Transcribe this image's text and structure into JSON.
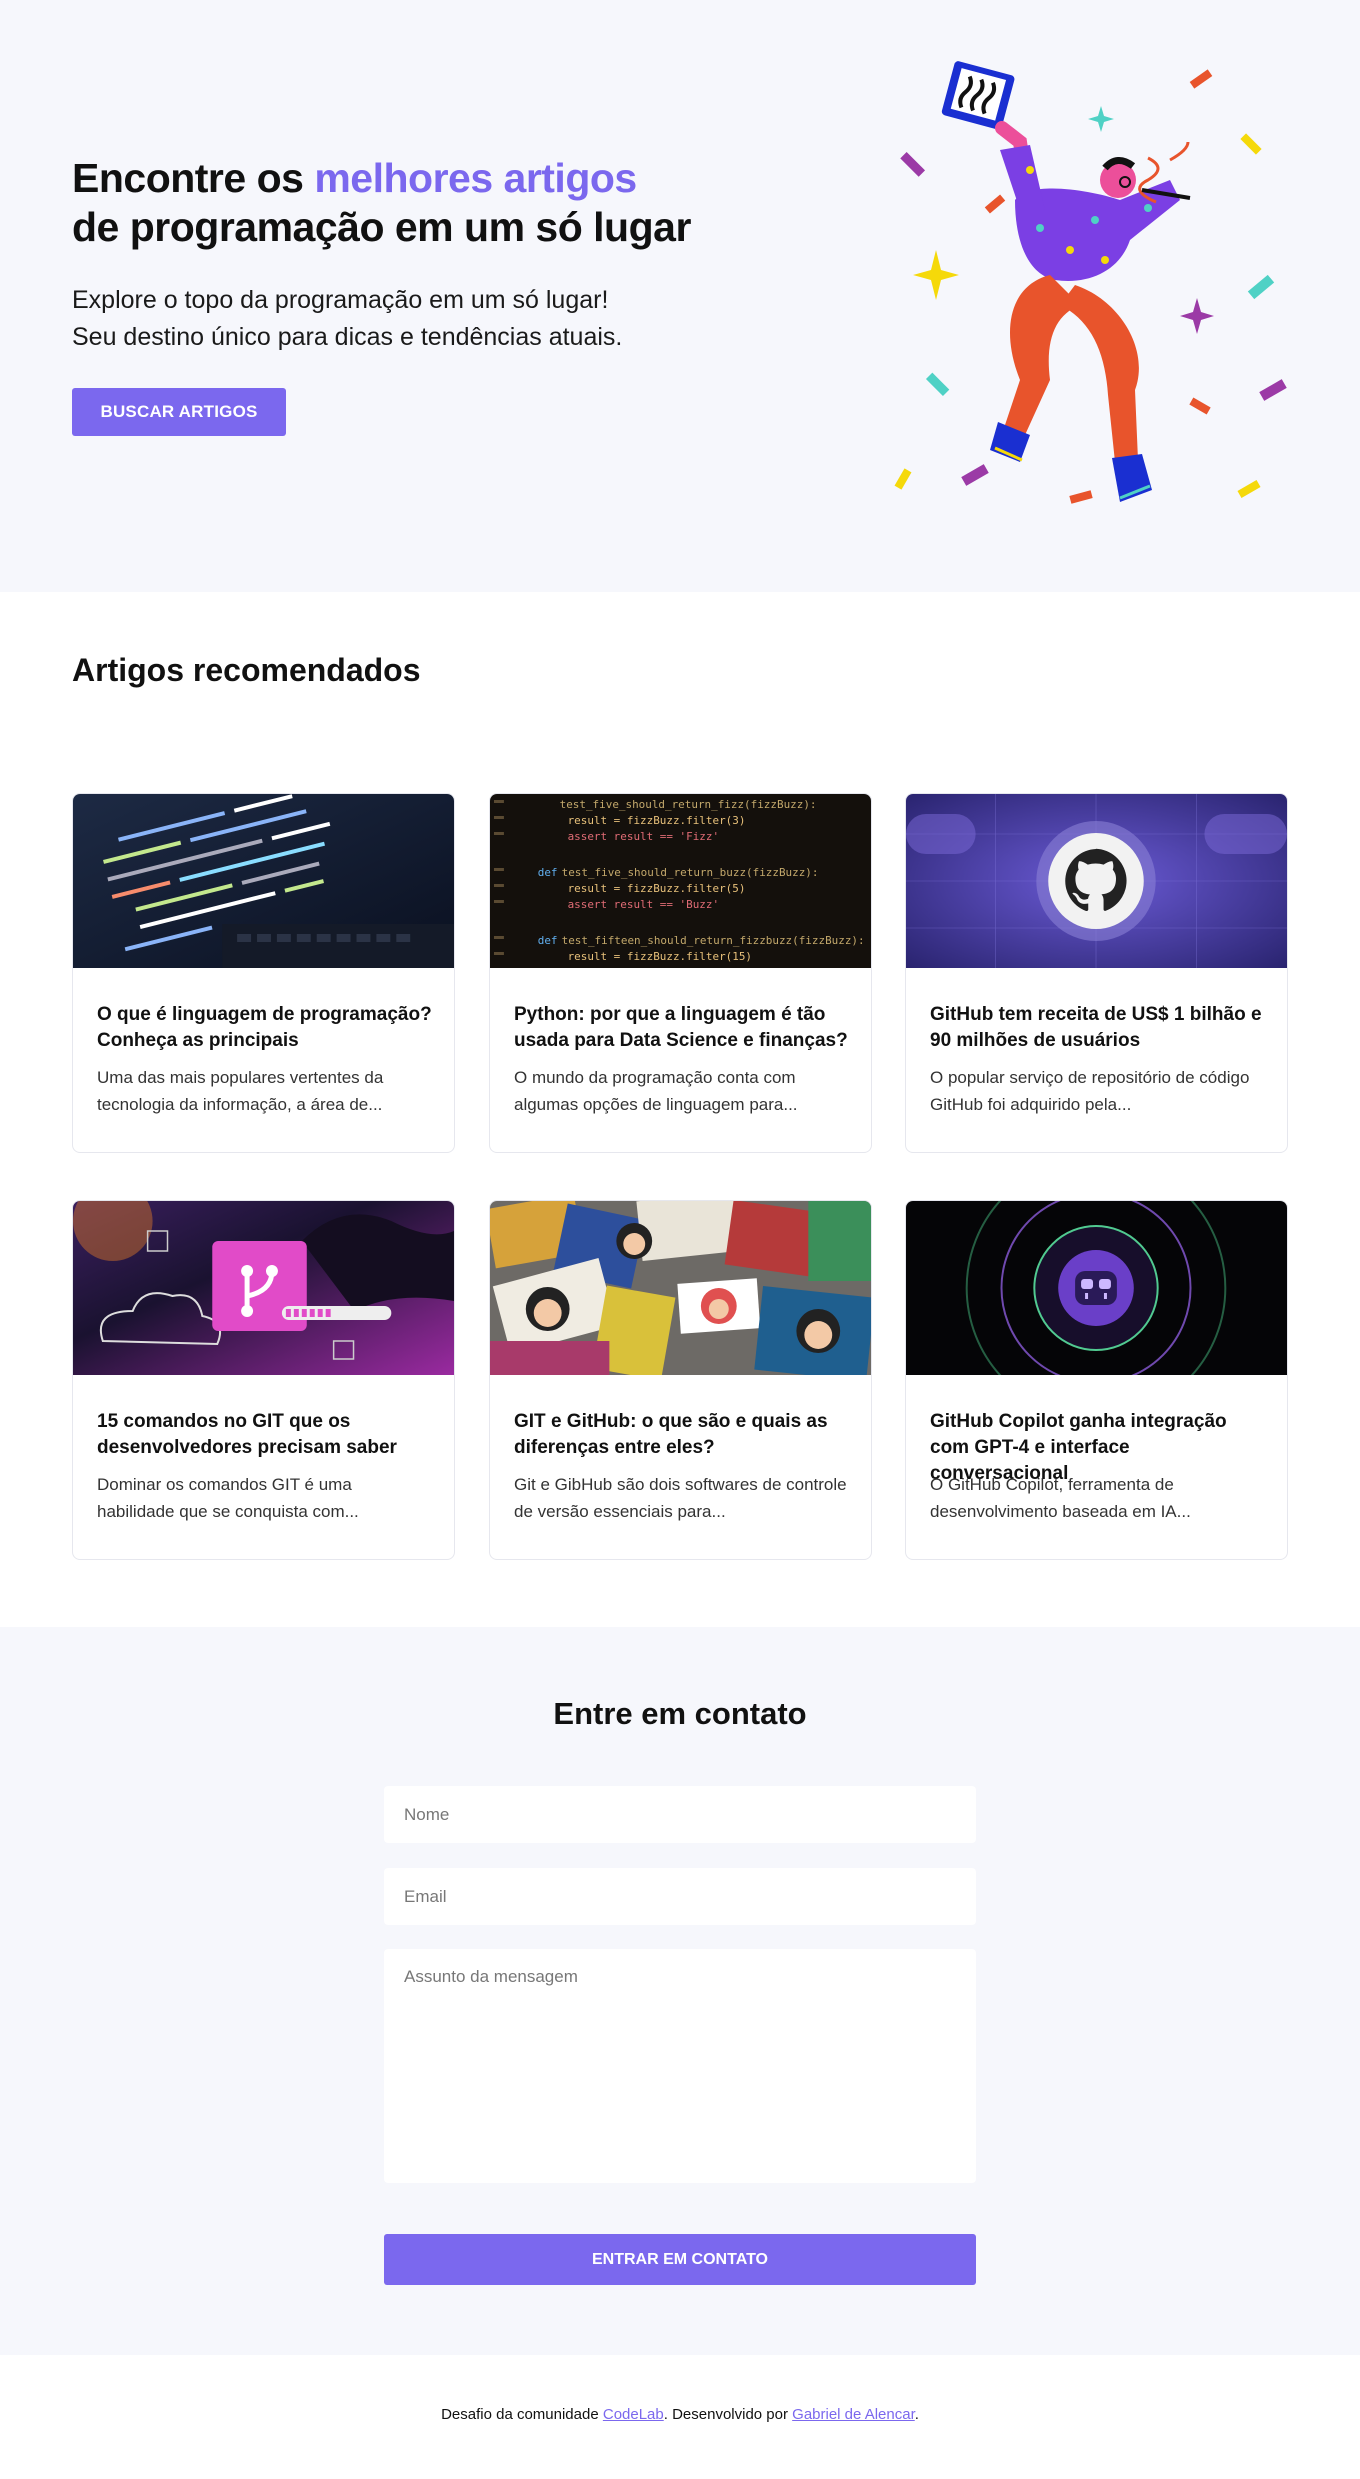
{
  "hero": {
    "title_part1": "Encontre os ",
    "title_accent": "melhores artigos",
    "title_part2": "de programação em um só lugar",
    "subtitle_line1": "Explore o topo da programação em um só lugar!",
    "subtitle_line2": "Seu destino único para dicas e tendências atuais.",
    "button_label": "Buscar artigos"
  },
  "articles": {
    "section_title": "Artigos recomendados",
    "items": [
      {
        "title": "O que é linguagem de programação? Conheça as principais",
        "excerpt": "Uma das mais populares vertentes da tecnologia da informação, a área de...",
        "image": "code-on-laptop-photo"
      },
      {
        "title": "Python: por que a linguagem é tão usada para Data Science e finanças?",
        "excerpt": "O mundo da programação conta com algumas opções de linguagem para...",
        "image": "python-code-screen-photo"
      },
      {
        "title": "GitHub tem receita de US$ 1 bilhão e 90 milhões de usuários",
        "excerpt": "O popular serviço de repositório de código GitHub foi adquirido pela...",
        "image": "github-logo-graphic"
      },
      {
        "title": "15 comandos no GIT que os desenvolvedores precisam saber",
        "excerpt": "Dominar os comandos GIT é uma habilidade que se conquista com...",
        "image": "git-branch-illustration"
      },
      {
        "title": "GIT e GitHub: o que são e quais as diferenças entre eles?",
        "excerpt": "Git e GibHub são dois softwares de controle de versão essenciais para...",
        "image": "octocat-stickers-photo"
      },
      {
        "title": "GitHub Copilot ganha integração com GPT-4 e interface conversacional",
        "excerpt": "O GitHub Copilot, ferramenta de desenvolvimento baseada em IA...",
        "image": "copilot-logo-graphic"
      }
    ]
  },
  "contact": {
    "title": "Entre em contato",
    "name_placeholder": "Nome",
    "email_placeholder": "Email",
    "message_placeholder": "Assunto da mensagem",
    "button_label": "Entrar em contato"
  },
  "footer": {
    "prefix": "Desafio da comunidade ",
    "community_link": "CodeLab",
    "middle": ". Desenvolvido por ",
    "author_link": "Gabriel de Alencar",
    "suffix": "."
  },
  "colors": {
    "accent": "#7b68ee",
    "hero_bg": "#f6f7fc",
    "text": "#111111"
  }
}
